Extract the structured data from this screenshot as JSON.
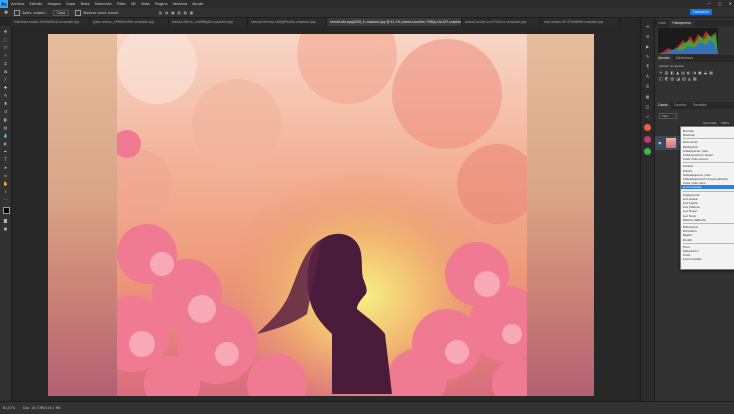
{
  "app": {
    "logo": "Ps"
  },
  "menu": [
    "Archivo",
    "Edición",
    "Imagen",
    "Capa",
    "Texto",
    "Selección",
    "Filtro",
    "3D",
    "Vista",
    "Plugins",
    "Ventana",
    "Ayuda"
  ],
  "window_controls": {
    "minimize": "—",
    "maximize": "▢",
    "close": "✕"
  },
  "options_bar": {
    "tool_icon": "move-tool-icon",
    "auto_select": "Selec. autom.:",
    "auto_select_value": "Capa",
    "show_transform": "Mostrar contr. transf.",
    "share": "Compartir"
  },
  "tabs": [
    {
      "label": "sharlinas-eaddc-9ct0A0f0o1i-unsplash.jpg",
      "active": false
    },
    {
      "label": "gitas-ramos-_e9f0XhihFek-unsplash.jpg",
      "active": false
    },
    {
      "label": "jessica-felicio-_mofBNqZe-unsplash.jpg",
      "active": false
    },
    {
      "label": "samuel-ferrara-1kfJfgPmp9A-unsplash.jpg",
      "active": false
    },
    {
      "label": "ahmet-atk-bpgj0ZlD_E-unsplash.jpg @ 61,1% (sarena-bonfan-7VWjq-Gw1XY-unsplash, RGB/8*)",
      "active": true
    },
    {
      "label": "pascal-muller-1cr07V0s-lo-unsplash.jpg",
      "active": false
    },
    {
      "label": "edu-lauton-OF-d7k9d6lM-unsplash.jpg",
      "active": false
    }
  ],
  "status": {
    "zoom": "61,07%",
    "doc": "Doc: 16,3 MB/126,7 MB"
  },
  "panels": {
    "top_tabs": [
      "Color",
      "Histograma"
    ],
    "adjust_tabs": [
      "Ajustes",
      "Bibliotecas"
    ],
    "adjust_label": "Añadir un ajuste",
    "layers_tabs": [
      "Capas",
      "Canales",
      "Trazados"
    ],
    "kind_label": "Tipo",
    "opacity_label": "Opacidad:",
    "opacity_value": "100%",
    "fill_label": "Relleno:",
    "fill_value": "100%",
    "layer_name": "sarena-bonfan-...-unsplash"
  },
  "blend_modes": {
    "selected": "Luminosidad",
    "groups": [
      [
        "Normal",
        "Disolver"
      ],
      [
        "Oscurecer",
        "Multiplicar",
        "Subexponer color",
        "Subexposición lineal",
        "Color más oscuro"
      ],
      [
        "Aclarar",
        "Trama",
        "Sobreexponer color",
        "Sobreexposición lineal (Añadir)",
        "Color más claro"
      ],
      [
        "Superponer",
        "Luz suave",
        "Luz fuerte",
        "Luz intensa",
        "Luz lineal",
        "Luz focal",
        "Mezcla definida"
      ],
      [
        "Diferencia",
        "Exclusión",
        "Restar",
        "Dividir"
      ],
      [
        "Tono",
        "Saturación",
        "Color",
        "Luminosidad"
      ]
    ],
    "menu_order": [
      "Normal",
      "Disolver",
      "Oscurecer",
      "Multiplicar",
      "Subexponer color",
      "Subexposición lineal",
      "Color más oscuro",
      "Aclarar",
      "Trama",
      "Sobreexponer color",
      "Sobreexposición lineal (Añadir)",
      "Color más claro",
      "Luminosidad",
      "Superponer",
      "Luz suave",
      "Luz fuerte",
      "Luz intensa",
      "Luz lineal",
      "Luz focal",
      "Mezcla definida",
      "Diferencia",
      "Exclusión",
      "Restar",
      "Dividir",
      "Tono",
      "Saturación",
      "Color",
      "Luminosidad"
    ]
  },
  "colors": {
    "accent": "#31a8ff",
    "selection": "#2f7fe0",
    "canvas_bg": "#282828",
    "photo_warm": "#e98a72"
  }
}
